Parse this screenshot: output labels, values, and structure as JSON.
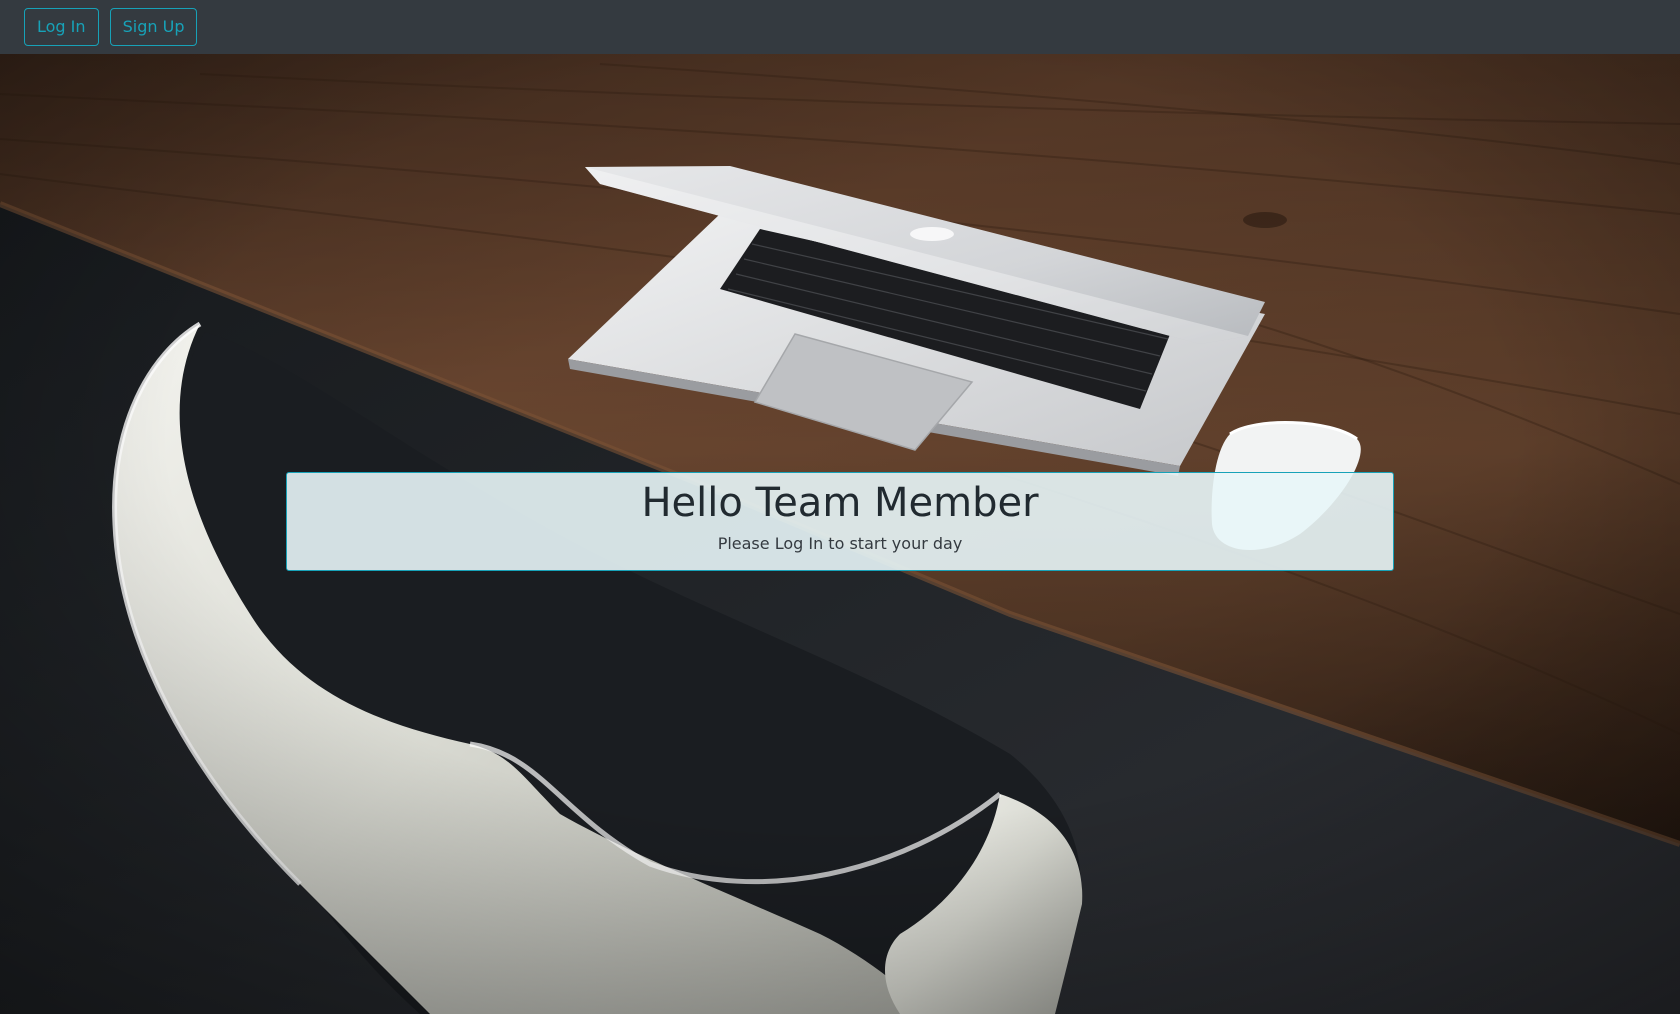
{
  "navbar": {
    "login_label": "Log In",
    "signup_label": "Sign Up"
  },
  "jumbotron": {
    "title": "Hello Team Member",
    "subtitle": "Please Log In to start your day"
  },
  "colors": {
    "navbar_bg": "#343a40",
    "accent": "#17a2b8",
    "card_bg": "#e8f6f8",
    "heading_text": "#212a30"
  },
  "hero_image": {
    "icons": [
      "desk-icon",
      "laptop-icon",
      "mouse-icon",
      "chair-icon"
    ]
  }
}
